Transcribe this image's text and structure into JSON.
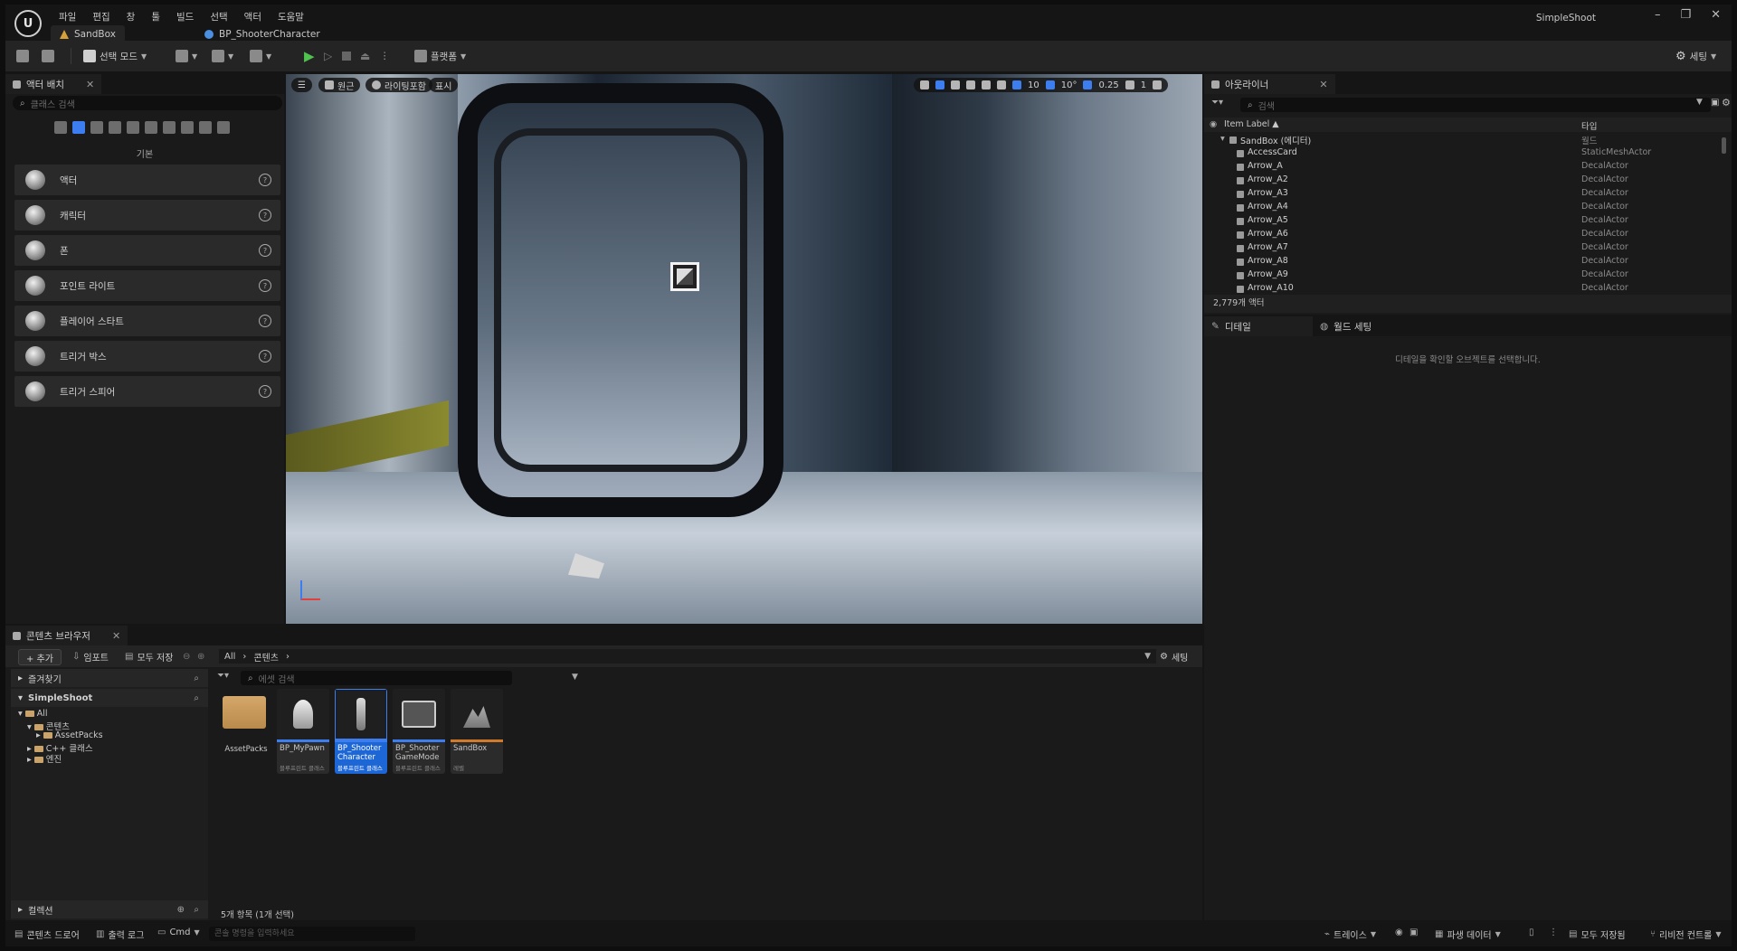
{
  "app": {
    "project_name": "SimpleShoot",
    "logo_text": "U",
    "menus": [
      "파일",
      "편집",
      "창",
      "툴",
      "빌드",
      "선택",
      "액터",
      "도움말"
    ],
    "tabs": [
      {
        "label": "SandBox",
        "active": true
      },
      {
        "label": "BP_ShooterCharacter",
        "active": false
      }
    ]
  },
  "toolbar": {
    "select_mode": "선택 모드",
    "platforms": "플랫폼",
    "settings": "세팅"
  },
  "place_actors": {
    "tab_label": "액터 배치",
    "search_placeholder": "클래스 검색",
    "category": "기본",
    "items": [
      "액터",
      "캐릭터",
      "폰",
      "포인트 라이트",
      "플레이어 스타트",
      "트리거 박스",
      "트리거 스피어"
    ]
  },
  "viewport": {
    "perspective": "원근",
    "lit_mode": "라이팅포함",
    "show": "표시",
    "grid_snap": "10",
    "rotation_snap": "10°",
    "scale_snap": "0.25",
    "camera_speed": "1"
  },
  "outliner": {
    "tab_label": "아웃라이너",
    "search_placeholder": "검색",
    "col_label": "Item Label ▲",
    "col_type": "타입",
    "rows": [
      {
        "name": "SandBox (에디터)",
        "type": "월드",
        "indent": 0
      },
      {
        "name": "AccessCard",
        "type": "StaticMeshActor",
        "indent": 1
      },
      {
        "name": "Arrow_A",
        "type": "DecalActor",
        "indent": 1
      },
      {
        "name": "Arrow_A2",
        "type": "DecalActor",
        "indent": 1
      },
      {
        "name": "Arrow_A3",
        "type": "DecalActor",
        "indent": 1
      },
      {
        "name": "Arrow_A4",
        "type": "DecalActor",
        "indent": 1
      },
      {
        "name": "Arrow_A5",
        "type": "DecalActor",
        "indent": 1
      },
      {
        "name": "Arrow_A6",
        "type": "DecalActor",
        "indent": 1
      },
      {
        "name": "Arrow_A7",
        "type": "DecalActor",
        "indent": 1
      },
      {
        "name": "Arrow_A8",
        "type": "DecalActor",
        "indent": 1
      },
      {
        "name": "Arrow_A9",
        "type": "DecalActor",
        "indent": 1
      },
      {
        "name": "Arrow_A10",
        "type": "DecalActor",
        "indent": 1
      }
    ],
    "actor_count": "2,779개 액터"
  },
  "details": {
    "tab_label": "디테일",
    "world_settings_label": "월드 세팅",
    "empty_message": "디테일을 확인할 오브젝트를 선택합니다."
  },
  "content_browser": {
    "tab_label": "콘텐츠 브라우저",
    "add_label": "+ 추가",
    "import_label": "임포트",
    "save_all_label": "모두 저장",
    "path": [
      "All",
      "콘텐츠"
    ],
    "settings_label": "세팅",
    "favorites_label": "즐겨찾기",
    "project_label": "SimpleShoot",
    "collections_label": "컬렉션",
    "asset_search_placeholder": "에셋 검색",
    "tree": [
      {
        "label": "All",
        "depth": 0
      },
      {
        "label": "콘텐츠",
        "depth": 1
      },
      {
        "label": "AssetPacks",
        "depth": 2
      },
      {
        "label": "C++ 클래스",
        "depth": 1
      },
      {
        "label": "엔진",
        "depth": 1
      }
    ],
    "folder": {
      "name": "AssetPacks"
    },
    "assets": [
      {
        "name": "BP_MyPawn",
        "type": "블루프린트 클래스",
        "selected": false
      },
      {
        "name": "BP_Shooter Character",
        "type": "블루프린트 클래스",
        "selected": true
      },
      {
        "name": "BP_Shooter GameMode",
        "type": "블루프린트 클래스",
        "selected": false
      },
      {
        "name": "SandBox",
        "type": "레벨",
        "selected": false
      }
    ],
    "status": "5개 항목 (1개 선택)"
  },
  "statusbar": {
    "content_drawer": "콘텐츠 드로어",
    "output_log": "출력 로그",
    "cmd": "Cmd",
    "cmd_placeholder": "콘솔 명령을 입력하세요",
    "trace": "트레이스",
    "derived_data": "파생 데이터",
    "save_all": "모두 저장됨",
    "revision_control": "리비전 컨트롤"
  },
  "colors": {
    "accent": "#3c7ef0",
    "panel": "#1a1a1a",
    "toolbar": "#242424"
  }
}
